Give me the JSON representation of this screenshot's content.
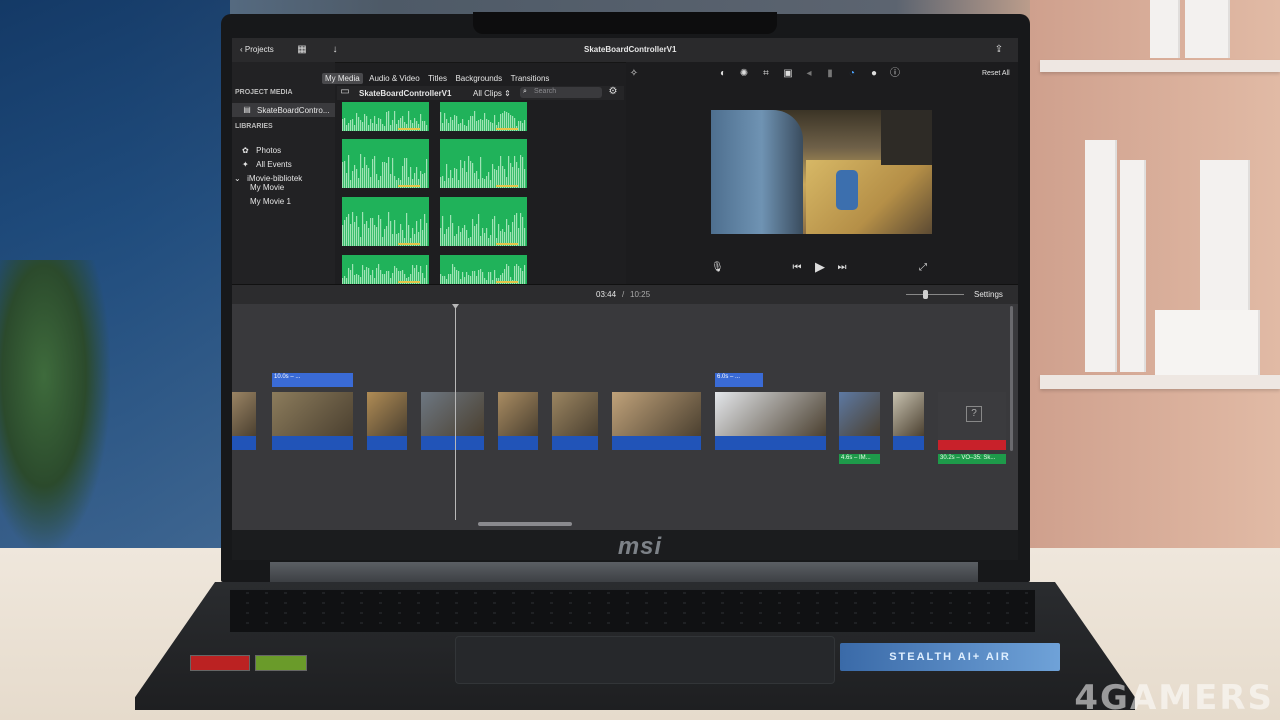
{
  "imovie": {
    "toolbar": {
      "projects_label": "Projects",
      "project_title": "SkateBoardControllerV1",
      "icons": [
        "chevron-left-icon",
        "film-icon",
        "download-arrow-icon",
        "share-icon"
      ]
    },
    "media_tabs": [
      "My Media",
      "Audio & Video",
      "Titles",
      "Backgrounds",
      "Transitions"
    ],
    "sidebar": {
      "project_media_heading": "PROJECT MEDIA",
      "project_item": "SkateBoardContro...",
      "libraries_heading": "LIBRARIES",
      "items": [
        "Photos",
        "All Events",
        "iMovie-bibliotek",
        "My Movie",
        "My Movie 1"
      ]
    },
    "browser": {
      "title": "SkateBoardControllerV1",
      "filter": "All Clips",
      "search_placeholder": "Search"
    },
    "viewer": {
      "reset_label": "Reset All",
      "adjust_icons": [
        "magic-wand-icon",
        "color-balance-icon",
        "color-palette-icon",
        "crop-icon",
        "camera-stabilize-icon",
        "volume-icon",
        "equalizer-icon",
        "speed-icon",
        "filter-icon",
        "info-icon"
      ]
    },
    "timeline": {
      "current_time": "03:44",
      "separator": "/",
      "total_time": "10:25",
      "settings_label": "Settings",
      "title_clip_1": "10.0s – ...",
      "title_clip_2": "6.0s – ...",
      "audio_clip_1": "4.6s – IM...",
      "audio_clip_2": "30.2s – VO–35: Sk...",
      "missing_clip_glyph": "?"
    }
  },
  "laptop": {
    "logo_text": "msi",
    "model_sticker": "STEALTH AI+ AIR"
  },
  "watermark": "4GAMERS",
  "colors": {
    "imovie_dark": "#1e1e20",
    "clip_green": "#20b25a",
    "audio_blue": "#2154b8",
    "title_blue": "#3a6bd6"
  }
}
